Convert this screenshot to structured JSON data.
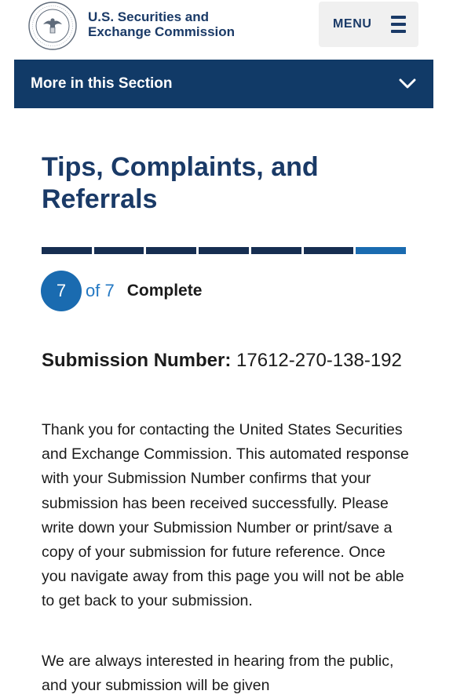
{
  "header": {
    "brand_line1": "U.S. Securities and",
    "brand_line2": "Exchange Commission",
    "menu_label": "MENU",
    "seal_icon": "sec-seal-logo",
    "colors": {
      "brand": "#1a3a67",
      "menu_bg": "#f0f0f0"
    }
  },
  "section_bar": {
    "label": "More in this Section",
    "icon": "chevron-down-icon",
    "colors": {
      "bg": "#113a67",
      "text": "#ffffff"
    }
  },
  "page": {
    "title": "Tips, Complaints, and Referrals"
  },
  "progress": {
    "total_steps": 7,
    "current_step": 7,
    "step_number": "7",
    "of_text": "of 7",
    "status": "Complete",
    "colors": {
      "done": "#162e51",
      "current": "#1a6bb0"
    }
  },
  "submission": {
    "label": "Submission Number:",
    "number": "17612-270-138-192"
  },
  "body": {
    "paragraph1": "Thank you for contacting the United States Securities and Exchange Commission. This automated response with your Submission Number confirms that your submission has been received successfully. Please write down your Submission Number or print/save a copy of your submission for future reference. Once you navigate away from this page you will not be able to get back to your submission.",
    "paragraph2": "We are always interested in hearing from the public, and your submission will be given"
  }
}
